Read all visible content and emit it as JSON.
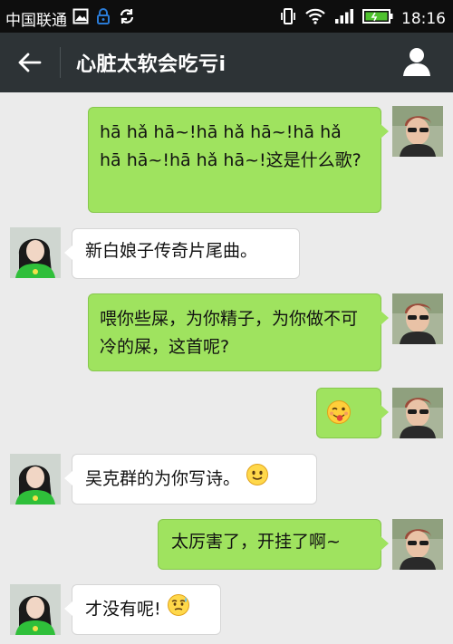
{
  "status_bar": {
    "carrier": "中国联通",
    "time": "18:16"
  },
  "title_bar": {
    "title": "心脏太软会吃亏i"
  },
  "messages": [
    {
      "side": "right",
      "text": "hā hǎ hā~!hā hǎ hā~!hā hǎ hā hā~!hā hǎ hā~!这是什么歌?"
    },
    {
      "side": "left",
      "text": "新白娘子传奇片尾曲。"
    },
    {
      "side": "right",
      "text": "喂你些屎，为你精子，为你做不可冷的屎，这首呢?"
    },
    {
      "side": "right",
      "emoji": "tongue-wink-emoji"
    },
    {
      "side": "left",
      "text": "吴克群的为你写诗。",
      "emoji": "smile-emoji"
    },
    {
      "side": "right",
      "text": "太厉害了，开挂了啊~"
    },
    {
      "side": "left",
      "text": "才没有呢!",
      "emoji": "shy-sweat-emoji"
    }
  ],
  "colors": {
    "right_bubble": "#9fe35f",
    "left_bubble": "#ffffff",
    "title_bar": "#2d3336",
    "background": "#ebebeb"
  }
}
